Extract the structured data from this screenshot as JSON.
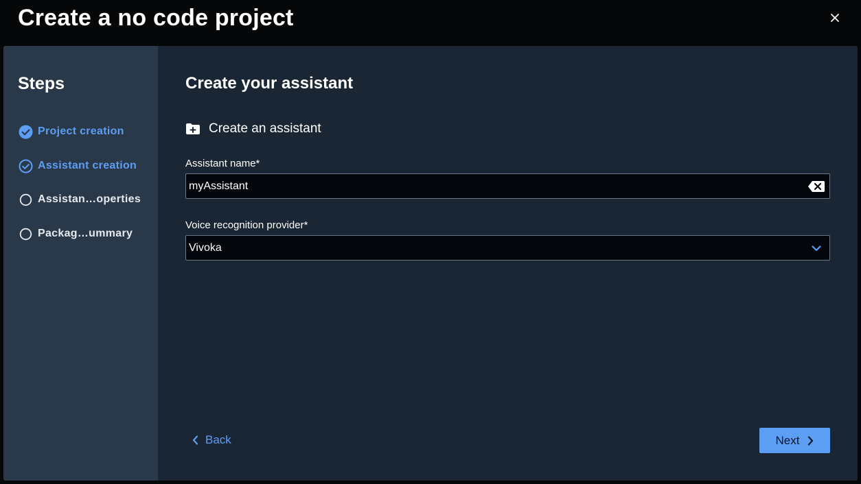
{
  "dialog": {
    "title": "Create a no code project"
  },
  "sidebar": {
    "title": "Steps",
    "steps": [
      {
        "label": "Project creation",
        "state": "completed"
      },
      {
        "label": "Assistant creation",
        "state": "current"
      },
      {
        "label": "Assistan…operties",
        "state": "pending"
      },
      {
        "label": "Packag…ummary",
        "state": "pending"
      }
    ]
  },
  "main": {
    "title": "Create your assistant",
    "section_label": "Create an assistant",
    "assistant_name": {
      "label": "Assistant name*",
      "value": "myAssistant"
    },
    "voice_provider": {
      "label": "Voice recognition provider*",
      "value": "Vivoka"
    }
  },
  "footer": {
    "back_label": "Back",
    "next_label": "Next"
  },
  "colors": {
    "accent": "#5d9ef5",
    "background": "#050708",
    "panel": "#1b2634",
    "sidebar": "#2a3949",
    "input_background": "#03070b"
  }
}
